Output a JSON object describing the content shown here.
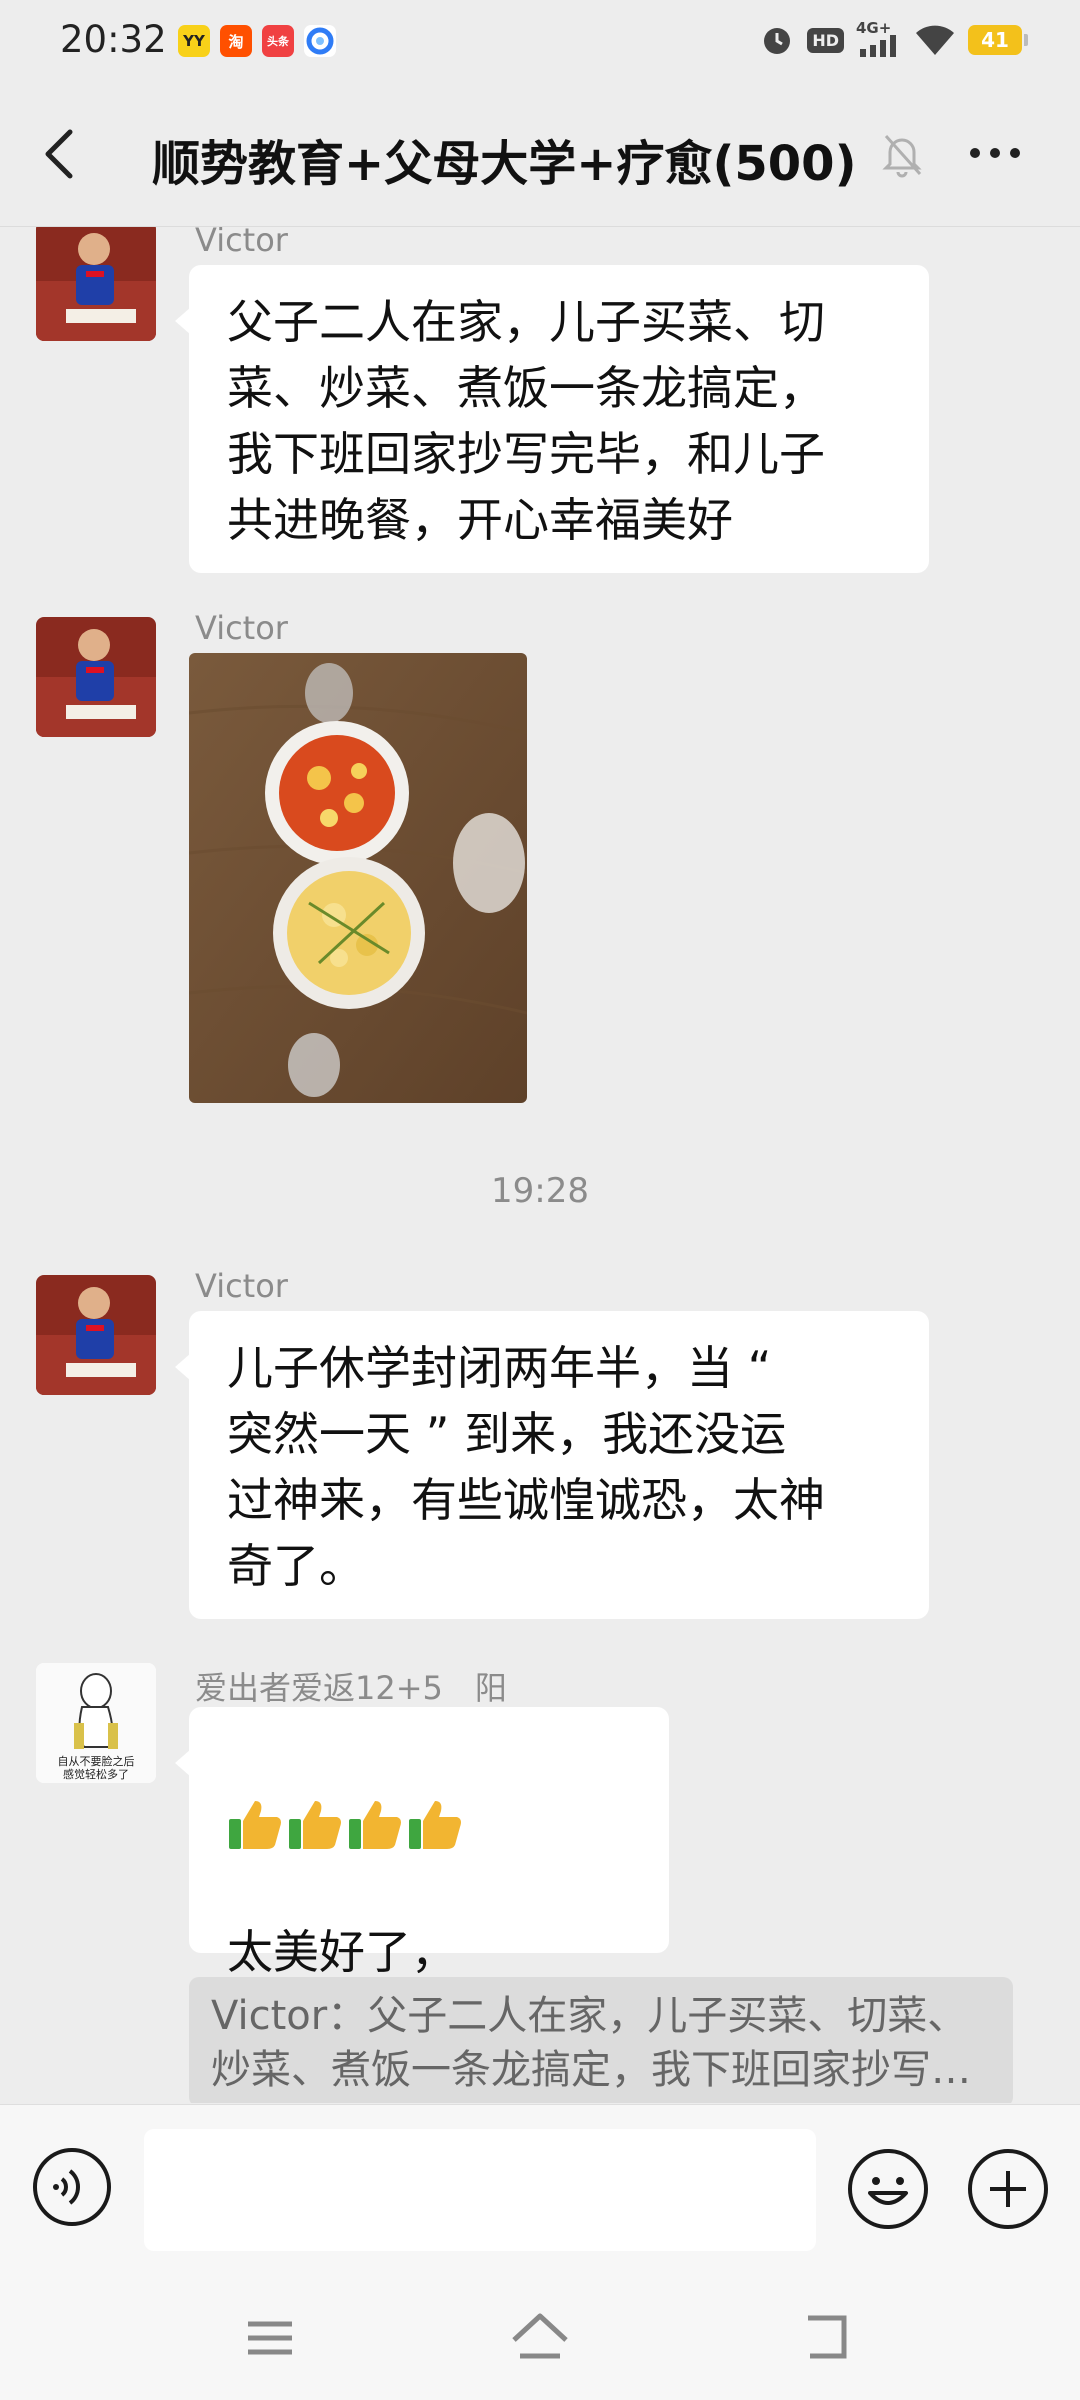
{
  "status_bar": {
    "time": "20:32",
    "app_badges": [
      {
        "icon": "yy-app-icon",
        "text": "YY",
        "bg": "#f8d119",
        "fg": "#222"
      },
      {
        "icon": "taobao-app-icon",
        "text": "淘",
        "bg": "#ff5000",
        "fg": "#fff"
      },
      {
        "icon": "toutiao-app-icon",
        "text": "头条",
        "bg": "#f04142",
        "fg": "#fff"
      },
      {
        "icon": "browser-app-icon",
        "text": "",
        "bg": "#ffffff",
        "fg": "#2f7cf6"
      }
    ],
    "network_label": "4G+",
    "hd_label": "HD",
    "battery_level": "41"
  },
  "header": {
    "title": "顺势教育+父母大学+疗愈(500)"
  },
  "messages": [
    {
      "sender": "Victor",
      "text": "父子二人在家，儿子买菜、切\n菜、炒菜、煮饭一条龙搞定，\n我下班回家抄写完毕，和儿子\n共进晚餐，开心幸福美好"
    },
    {
      "sender": "Victor",
      "image": "photo-dinner-two-bowls"
    },
    {
      "timestamp": "19:28"
    },
    {
      "sender": "Victor",
      "text": "儿子休学封闭两年半，当 “\n突然一天 ” 到来，我还没运\n过神来，有些诚惶诚恐，太神\n奇了。"
    },
    {
      "sender": "爱出者爱返12+5　阳",
      "emoji": "thumbs-up ×4",
      "text": "太美好了，\n幸福来的有点突然",
      "avatar_caption": "自从不要脸之后\n感觉轻松多了",
      "quote": "Victor：父子二人在家，儿子买菜、切菜、炒菜、煮饭一条龙搞定，我下班回家抄写完毕，和儿子共进晚餐，开心幸福美好"
    }
  ],
  "input": {
    "placeholder": ""
  },
  "colors": {
    "background": "#ededed",
    "bubble": "#ffffff",
    "meta_text": "#8b8b8b",
    "quote_bg": "#dcdcdc"
  }
}
